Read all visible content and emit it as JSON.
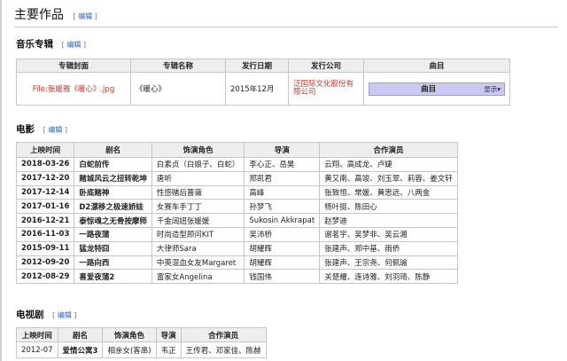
{
  "page_title": "主要作品",
  "edit_label": "编辑",
  "music": {
    "title": "音乐专辑",
    "headers": [
      "专辑封面",
      "专辑名称",
      "发行日期",
      "发行公司",
      "曲目"
    ],
    "rows": [
      {
        "cover": "File:张媛雅《暖心》.jpg",
        "name": "《暖心》",
        "date": "2015年12月",
        "company": "泛国际文化股份有限公司",
        "track_label": "曲目",
        "track_toggle": "显示▾"
      }
    ]
  },
  "film": {
    "title": "电影",
    "headers": [
      "上映时间",
      "剧名",
      "饰演角色",
      "导演",
      "合作演员"
    ],
    "rows": [
      {
        "date": "2018-03-26",
        "title": "白蛇前传",
        "role": "白素贞（白娘子、白蛇）",
        "director": "李心正、岳昊",
        "cast": "云翔、高成龙、卢婕"
      },
      {
        "date": "2017-12-20",
        "title": "赌城风云之扭转乾坤",
        "role": "唐听",
        "director": "郑凯君",
        "cast": "黄又南、高竣、刘玉翠、莉蓉、姜文轩"
      },
      {
        "date": "2017-12-14",
        "title": "卧底赌神",
        "role": "性感赌后蔷薇",
        "director": "高峰",
        "cast": "张致恒、常媛、黄思远、八两金"
      },
      {
        "date": "2017-01-16",
        "title": "D2漂移之极速娇娃",
        "role": "女赛车手丁丁",
        "director": "孙梦飞",
        "cast": "杨叶挺、陈田心"
      },
      {
        "date": "2016-12-21",
        "title": "泰惊魂之无骨按摩师",
        "role": "千金阔妞张媛媛",
        "director": "Sukosin Akkrapat",
        "cast": "赵梦迪"
      },
      {
        "date": "2016-11-03",
        "title": "一路夜蒲",
        "role": "时尚造型顾问KIT",
        "director": "吴沛桥",
        "cast": "谢茗宇、吴梦非、吴云湘"
      },
      {
        "date": "2015-09-11",
        "title": "猛龙特囧",
        "role": "大律师Sara",
        "director": "胡耀辉",
        "cast": "张建声、郑中基、雨侨"
      },
      {
        "date": "2012-09-20",
        "title": "一路向西",
        "role": "中英混血女友Margaret",
        "director": "胡耀辉",
        "cast": "张建声、王宗尧、何佩瑜"
      },
      {
        "date": "2012-08-29",
        "title": "喜爱夜蒲2",
        "role": "富家女Angelina",
        "director": "钱国伟",
        "cast": "关楚耀、连诗雅、刘羽琦、陈静"
      }
    ]
  },
  "tv": {
    "title": "电视剧",
    "headers": [
      "上映时间",
      "剧名",
      "饰演角色",
      "导演",
      "合作演员"
    ],
    "rows": [
      {
        "date": "2012-07",
        "title": "爱情公寓3",
        "role": "相亲女(客串)",
        "director": "韦正",
        "cast": "王传君、邓家佳、陈赫"
      }
    ]
  }
}
